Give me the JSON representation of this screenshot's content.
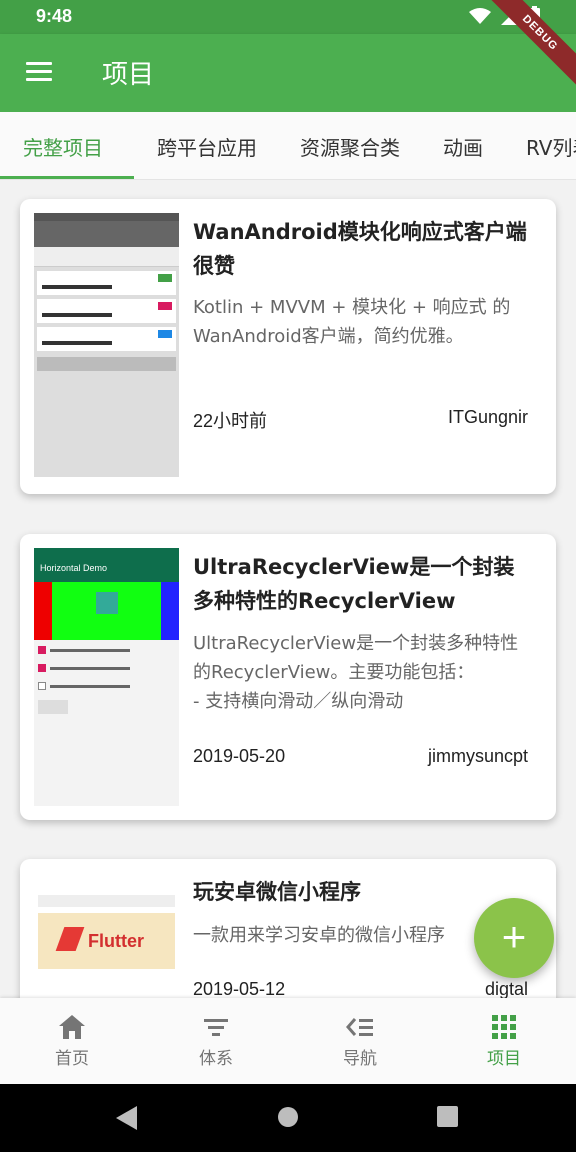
{
  "status": {
    "time": "9:48"
  },
  "debug_banner": "DEBUG",
  "app_bar": {
    "title": "项目"
  },
  "tabs": [
    "完整项目",
    "跨平台应用",
    "资源聚合类",
    "动画",
    "RV列表"
  ],
  "colors": {
    "primary": "#4caf50",
    "primary_dark": "#43a047",
    "fab": "#8bc34a",
    "active_tab": "#43a047"
  },
  "projects": [
    {
      "title": "WanAndroid模块化响应式客户端很赞",
      "desc": "Kotlin + MVVM + 模块化 + 响应式 的WanAndroid客户端，简约优雅。",
      "date": "22小时前",
      "author": "ITGungnir"
    },
    {
      "title": "UltraRecyclerView是一个封装多种特性的RecyclerView",
      "desc": "UltraRecyclerView是一个封装多种特性的RecyclerView。主要功能包括：\n- 支持横向滑动／纵向滑动",
      "date": "2019-05-20",
      "author": "jimmysuncpt"
    },
    {
      "title": "玩安卓微信小程序",
      "desc": "一款用来学习安卓的微信小程序",
      "date": "2019-05-12",
      "author": "digtal"
    }
  ],
  "thumbs": {
    "t2_header": "Horizontal Demo",
    "t3_banner": "Flutter"
  },
  "fab": {
    "icon": "plus-icon",
    "label": "+"
  },
  "bottom_nav": [
    {
      "label": "首页",
      "icon": "home-icon"
    },
    {
      "label": "体系",
      "icon": "filter-list-icon"
    },
    {
      "label": "导航",
      "icon": "navigation-list-icon"
    },
    {
      "label": "项目",
      "icon": "apps-grid-icon"
    }
  ],
  "system_nav": [
    "back-icon",
    "home-circle-icon",
    "recents-icon"
  ]
}
